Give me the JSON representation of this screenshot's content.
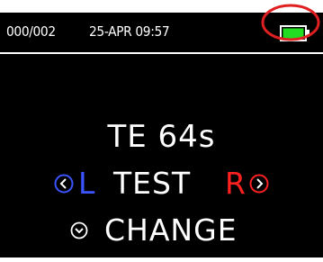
{
  "status_bar": {
    "record_counter": "000/002",
    "date_time": "25-APR 09:57",
    "battery": {
      "icon": "battery-full-icon",
      "level": 1.0,
      "color": "#22dd22"
    }
  },
  "main": {
    "test_duration": "TE 64s",
    "ear_selector": {
      "left_ear_letter": "L",
      "test_label": "TEST",
      "right_ear_letter": "R",
      "left_arrow_icon": "chevron-left-icon",
      "right_arrow_icon": "chevron-right-icon",
      "left_color": "#3a55ff",
      "right_color": "#ff2020"
    },
    "change": {
      "label": "CHANGE",
      "icon": "chevron-down-icon"
    }
  },
  "annotation": {
    "highlight_color": "#e02020"
  }
}
